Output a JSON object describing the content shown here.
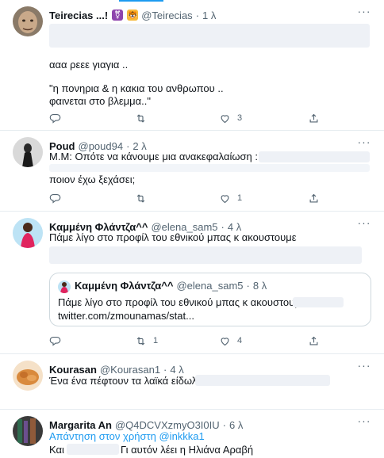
{
  "tweets": [
    {
      "name": "Teirecias ...!",
      "handle": "@Teirecias",
      "time": "1 λ",
      "badges": [
        "purple-square",
        "tiger-face"
      ],
      "lines": [
        "ααα ρεεε γιαγια ..",
        "\"η πονηρια & η κακια του ανθρωπου ..",
        "φαινεται στο βλεμμα..\""
      ],
      "likes": "3",
      "retweets": "",
      "replies": ""
    },
    {
      "name": "Poud",
      "handle": "@poud94",
      "time": "2 λ",
      "lines": [
        "M.M: Οπότε να κάνουμε μια ανακεφαλαίωση :",
        "ποιον έχω ξεχάσει;"
      ],
      "likes": "1",
      "retweets": "",
      "replies": ""
    },
    {
      "name": "Καμμένη Φλάντζα^^",
      "handle": "@elena_sam5",
      "time": "4 λ",
      "lines": [
        "Πάμε λίγο στο προφίλ του εθνικού μπας κ ακουστουμε"
      ],
      "quote": {
        "name": "Καμμένη Φλάντζα^^",
        "handle": "@elena_sam5",
        "time": "8 λ",
        "line1": "Πάμε λίγο στο προφίλ του εθνικού μπας κ ακουστουμε",
        "line2": "twitter.com/zmounamas/stat..."
      },
      "retweets": "1",
      "likes": "4",
      "replies": ""
    },
    {
      "name": "Kourasan",
      "handle": "@Kourasan1",
      "time": "4 λ",
      "lines": [
        "Ένα ένα πέφτουν τα λαϊκά είδωλα"
      ]
    },
    {
      "name": "Margarita An",
      "handle": "@Q4DCVXzmyO3I0IU",
      "time": "6 λ",
      "reply_prefix": "Απάντηση στον χρήστη",
      "reply_to": "@inkkka1",
      "lines": [
        "Και",
        "Γι αυτόν λέει η Ηλιάνα Αραβή"
      ]
    }
  ],
  "colors": {
    "accent": "#1d9bf0",
    "text": "#0f1419",
    "muted": "#536471",
    "divider": "#e6ecf0"
  },
  "icons": [
    "reply-icon",
    "retweet-icon",
    "like-icon",
    "share-icon",
    "more-icon"
  ],
  "more_glyph": "···"
}
